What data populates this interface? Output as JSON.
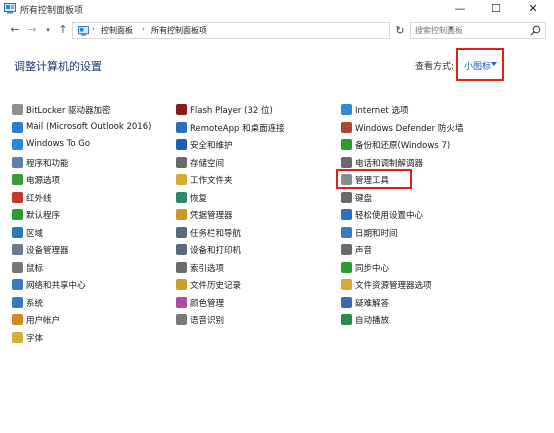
{
  "window": {
    "title": "所有控制面板项",
    "minimize_glyph": "—",
    "maximize_glyph": "☐",
    "close_glyph": "✕"
  },
  "address": {
    "back_glyph": "←",
    "forward_glyph": "→",
    "history_glyph": "▾",
    "up_glyph": "↑",
    "sep_glyph": "›",
    "crumbs": [
      "控制面板",
      "所有控制面板项"
    ],
    "dropdown_glyph": "▾",
    "refresh_glyph": "↻",
    "search_placeholder": "搜索控制面板"
  },
  "header": {
    "title": "调整计算机的设置",
    "view_by_label": "查看方式:",
    "view_by_value": "小图标"
  },
  "columns": [
    [
      {
        "label": "BitLocker 驱动器加密",
        "icon": "bitlocker-icon",
        "color": "#8a8f98"
      },
      {
        "label": "Mail (Microsoft Outlook 2016)",
        "icon": "mail-icon",
        "color": "#2d7dd2"
      },
      {
        "label": "Windows To Go",
        "icon": "windows-to-go-icon",
        "color": "#2b8ad8"
      },
      {
        "label": "程序和功能",
        "icon": "programs-icon",
        "color": "#5a7fa8"
      },
      {
        "label": "电源选项",
        "icon": "power-icon",
        "color": "#3a9a3a"
      },
      {
        "label": "红外线",
        "icon": "infrared-icon",
        "color": "#c0392b"
      },
      {
        "label": "默认程序",
        "icon": "default-programs-icon",
        "color": "#2d9b2d"
      },
      {
        "label": "区域",
        "icon": "region-icon",
        "color": "#2a7ab8"
      },
      {
        "label": "设备管理器",
        "icon": "device-manager-icon",
        "color": "#6b7b8c"
      },
      {
        "label": "鼠标",
        "icon": "mouse-icon",
        "color": "#777777"
      },
      {
        "label": "网络和共享中心",
        "icon": "network-icon",
        "color": "#3a78c0"
      },
      {
        "label": "系统",
        "icon": "system-icon",
        "color": "#3a78c0"
      },
      {
        "label": "用户帐户",
        "icon": "user-accounts-icon",
        "color": "#d08a2a"
      },
      {
        "label": "字体",
        "icon": "fonts-icon",
        "color": "#d4b03a"
      }
    ],
    [
      {
        "label": "Flash Player (32 位)",
        "icon": "flash-icon",
        "color": "#8b1a1a"
      },
      {
        "label": "RemoteApp 和桌面连接",
        "icon": "remoteapp-icon",
        "color": "#2a6fc0"
      },
      {
        "label": "安全和维护",
        "icon": "security-flag-icon",
        "color": "#1f5fb4"
      },
      {
        "label": "存储空间",
        "icon": "storage-icon",
        "color": "#6a6a6a"
      },
      {
        "label": "工作文件夹",
        "icon": "work-folders-icon",
        "color": "#d8a838"
      },
      {
        "label": "恢复",
        "icon": "recovery-icon",
        "color": "#2a8a6a"
      },
      {
        "label": "凭据管理器",
        "icon": "credential-icon",
        "color": "#c89a2a"
      },
      {
        "label": "任务栏和导航",
        "icon": "taskbar-icon",
        "color": "#5a6a7a"
      },
      {
        "label": "设备和打印机",
        "icon": "printer-icon",
        "color": "#5a6a7a"
      },
      {
        "label": "索引选项",
        "icon": "indexing-icon",
        "color": "#6a6a6a"
      },
      {
        "label": "文件历史记录",
        "icon": "file-history-icon",
        "color": "#c8a030"
      },
      {
        "label": "颜色管理",
        "icon": "color-management-icon",
        "color": "#b04aa0"
      },
      {
        "label": "语音识别",
        "icon": "speech-icon",
        "color": "#7a7a7a"
      }
    ],
    [
      {
        "label": "Internet 选项",
        "icon": "internet-options-icon",
        "color": "#2d8ad8"
      },
      {
        "label": "Windows Defender 防火墙",
        "icon": "firewall-icon",
        "color": "#b0462a"
      },
      {
        "label": "备份和还原(Windows 7)",
        "icon": "backup-icon",
        "color": "#2d9b2d"
      },
      {
        "label": "电话和调制解调器",
        "icon": "phone-icon",
        "color": "#6a6a6a"
      },
      {
        "label": "管理工具",
        "icon": "admin-tools-icon",
        "color": "#8a8a8a"
      },
      {
        "label": "键盘",
        "icon": "keyboard-icon",
        "color": "#6a6a6a"
      },
      {
        "label": "轻松使用设置中心",
        "icon": "ease-of-access-icon",
        "color": "#2d6fc0"
      },
      {
        "label": "日期和时间",
        "icon": "date-time-icon",
        "color": "#3a7ac0"
      },
      {
        "label": "声音",
        "icon": "sound-icon",
        "color": "#6a6a6a"
      },
      {
        "label": "同步中心",
        "icon": "sync-center-icon",
        "color": "#2a9a3a"
      },
      {
        "label": "文件资源管理器选项",
        "icon": "folder-options-icon",
        "color": "#d8a838"
      },
      {
        "label": "疑难解答",
        "icon": "troubleshooting-icon",
        "color": "#3a6aa8"
      },
      {
        "label": "自动播放",
        "icon": "autoplay-icon",
        "color": "#2a8a4a"
      }
    ]
  ]
}
